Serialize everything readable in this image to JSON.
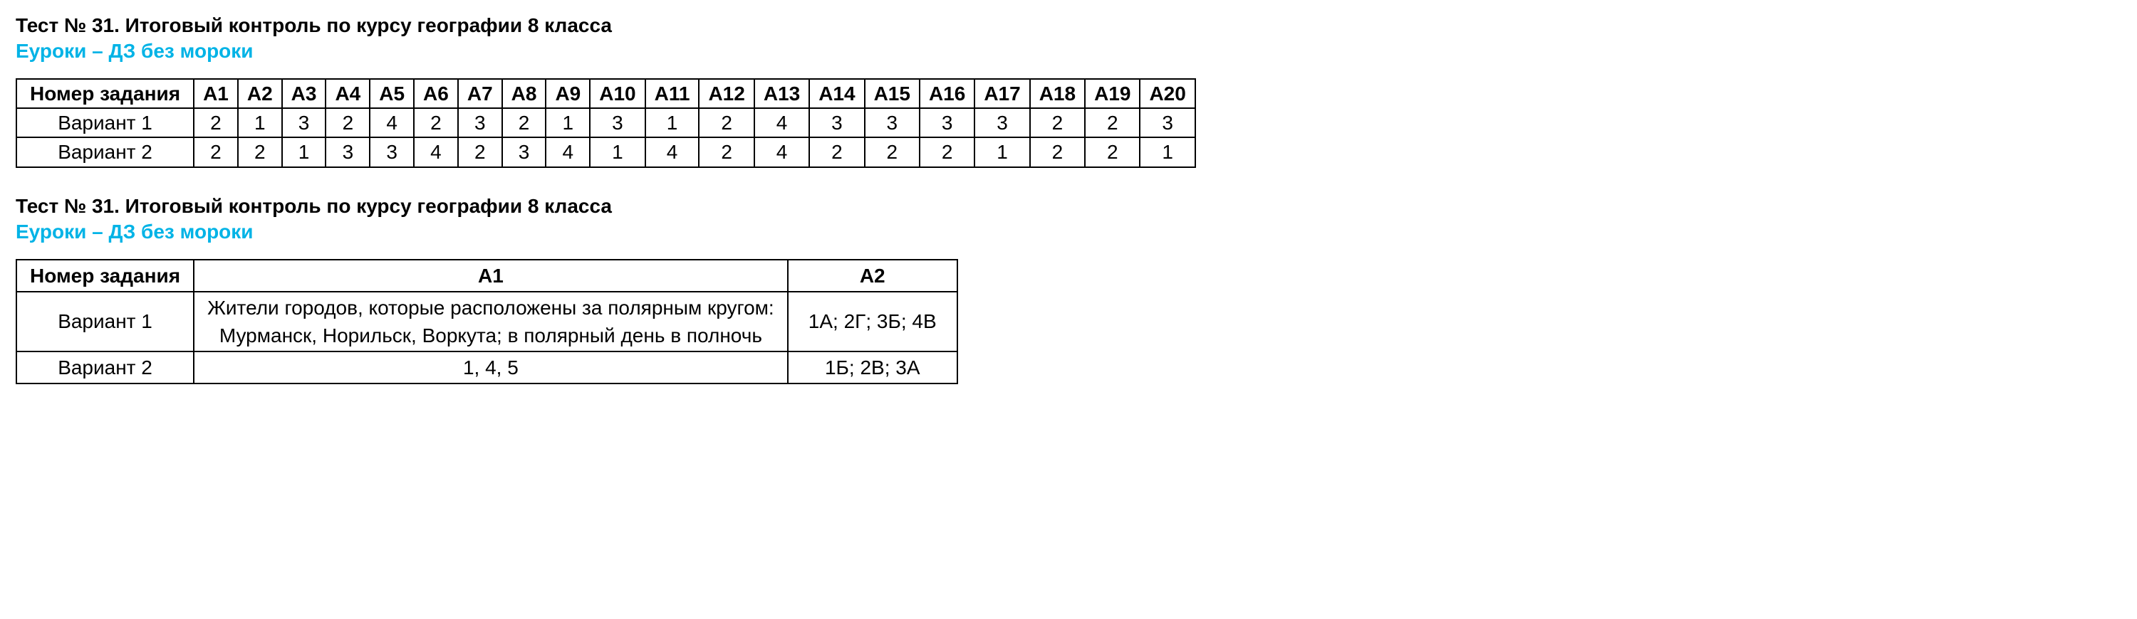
{
  "section1": {
    "title": "Тест № 31. Итоговый контроль по курсу географии 8 класса",
    "subtitle": "Еуроки – ДЗ без мороки",
    "header_label": "Номер задания",
    "columns": [
      "А1",
      "А2",
      "А3",
      "А4",
      "А5",
      "А6",
      "А7",
      "А8",
      "А9",
      "А10",
      "А11",
      "А12",
      "А13",
      "А14",
      "А15",
      "А16",
      "А17",
      "А18",
      "А19",
      "А20"
    ],
    "rows": [
      {
        "label": "Вариант 1",
        "values": [
          "2",
          "1",
          "3",
          "2",
          "4",
          "2",
          "3",
          "2",
          "1",
          "3",
          "1",
          "2",
          "4",
          "3",
          "3",
          "3",
          "3",
          "2",
          "2",
          "3"
        ]
      },
      {
        "label": "Вариант 2",
        "values": [
          "2",
          "2",
          "1",
          "3",
          "3",
          "4",
          "2",
          "3",
          "4",
          "1",
          "4",
          "2",
          "4",
          "2",
          "2",
          "2",
          "1",
          "2",
          "2",
          "1"
        ]
      }
    ]
  },
  "section2": {
    "title": "Тест № 31. Итоговый контроль по курсу географии 8 класса",
    "subtitle": "Еуроки – ДЗ без мороки",
    "header_label": "Номер задания",
    "columns": [
      "А1",
      "А2"
    ],
    "rows": [
      {
        "label": "Вариант 1",
        "a1_line1": "Жители городов, которые расположены за полярным кругом:",
        "a1_line2": "Мурманск, Норильск, Воркута; в полярный день в полночь",
        "a2": "1А; 2Г; 3Б; 4В"
      },
      {
        "label": "Вариант 2",
        "a1_line1": "1, 4, 5",
        "a1_line2": "",
        "a2": "1Б; 2В; 3А"
      }
    ]
  }
}
